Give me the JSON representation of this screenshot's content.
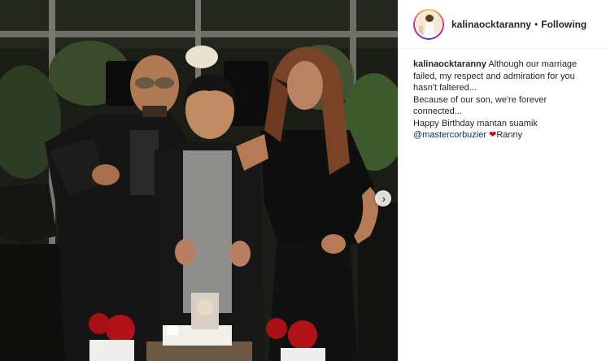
{
  "post": {
    "username": "kalinaocktaranny",
    "separator": "•",
    "follow_status": "Following",
    "caption": {
      "author": "kalinaocktaranny",
      "line1_rest": "Although our marriage failed, my respect and admiration for you hasn't faltered...",
      "line2": "Because of our son, we're forever connected...",
      "line3": "Happy Birthday mantan suamik",
      "mention": "@mastercorbuzier",
      "heart_icon": "red-heart-emoji",
      "sign": "Ranny"
    },
    "media": {
      "next_icon": "chevron-right-icon",
      "next_symbol": "›"
    }
  },
  "colors": {
    "mention": "#003569",
    "text": "#262626",
    "heart": "#d0021b"
  }
}
